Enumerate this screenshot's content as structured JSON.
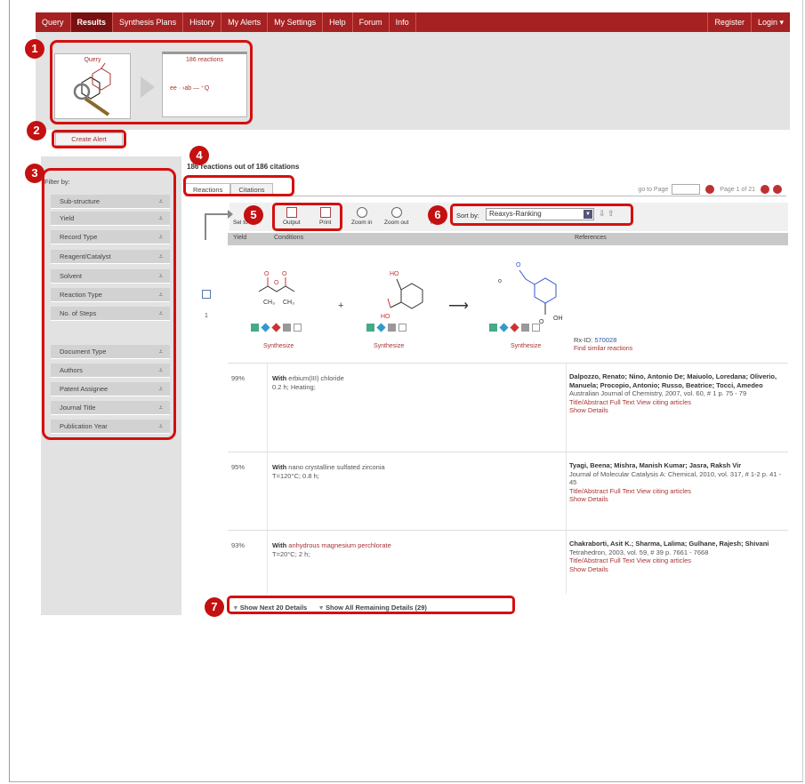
{
  "nav": {
    "items": [
      "Query",
      "Results",
      "Synthesis Plans",
      "History",
      "My Alerts",
      "My Settings",
      "Help",
      "Forum",
      "Info"
    ],
    "active": "Results",
    "right_items": [
      "Register",
      "Login ▾"
    ]
  },
  "thumbs": {
    "query_label": "Query",
    "reactions_label": "186 reactions"
  },
  "create_alert": "Create Alert",
  "headline": "186 reactions out of 186 citations",
  "tabs": [
    "Reactions",
    "Citations"
  ],
  "pager": {
    "goto_label": "go to Page",
    "page_text": "Page 1 of 21"
  },
  "toolbar": {
    "select_label": "Sel to",
    "output": "Output",
    "print": "Print",
    "zoom_in": "Zoom in",
    "zoom_out": "Zoom out",
    "hide": "Hide",
    "sort_label": "Sort by:",
    "sort_value": "Reaxys-Ranking"
  },
  "columns": [
    "Yield",
    "Conditions",
    "References"
  ],
  "filter": {
    "title": "Filter by:",
    "facets": [
      "Sub-structure",
      "Yield",
      "Record Type",
      "Reagent/Catalyst",
      "Solvent",
      "Reaction Type",
      "No. of Steps"
    ],
    "facets2": [
      "Document Type",
      "Authors",
      "Patent Assignee",
      "Journal Title",
      "Publication Year"
    ]
  },
  "reaction": {
    "row_number": "1",
    "synthesize": "Synthesize",
    "rx_id_label": "Rx-ID:",
    "rx_id": "570028",
    "similar": "Find similar reactions"
  },
  "rows": [
    {
      "yield": "99%",
      "with": "With",
      "reagent": "erbium(III) chloride",
      "conditions": "0.2 h; Heating;",
      "authors": "Dalpozzo, Renato; Nino, Antonio De; Maiuolo, Loredana; Oliverio, Manuela; Procopio, Antonio; Russo, Beatrice; Tocci, Amedeo",
      "citation": "Australian Journal of Chemistry, 2007, vol. 60, # 1 p. 75 - 79",
      "links": "Title/Abstract   Full Text   View citing articles",
      "details": "Show Details"
    },
    {
      "yield": "95%",
      "with": "With",
      "reagent": "nano crystalline sulfated zirconia",
      "conditions": "T=120°C; 0.8 h;",
      "authors": "Tyagi, Beena; Mishra, Manish Kumar; Jasra, Raksh Vir",
      "citation": "Journal of Molecular Catalysis A: Chemical, 2010, vol. 317, # 1-2 p. 41 - 45",
      "links": "Title/Abstract   Full Text   View citing articles",
      "details": "Show Details"
    },
    {
      "yield": "93%",
      "with": "With",
      "reagent": "anhydrous magnesium perchlorate",
      "conditions": "T=20°C; 2 h;",
      "authors": "Chakraborti, Asit K.; Sharma, Lalima; Gulhane, Rajesh; Shivani",
      "citation": "Tetrahedron, 2003, vol. 59, # 39 p. 7661 - 7668",
      "links": "Title/Abstract   Full Text   View citing articles",
      "details": "Show Details"
    }
  ],
  "footer": {
    "next": "Show Next 20 Details",
    "all": "Show All Remaining Details (29)"
  },
  "callouts": [
    "1",
    "2",
    "3",
    "4",
    "5",
    "6",
    "7"
  ],
  "colors": {
    "brand_red": "#a62121",
    "callout_red": "#d41010"
  }
}
